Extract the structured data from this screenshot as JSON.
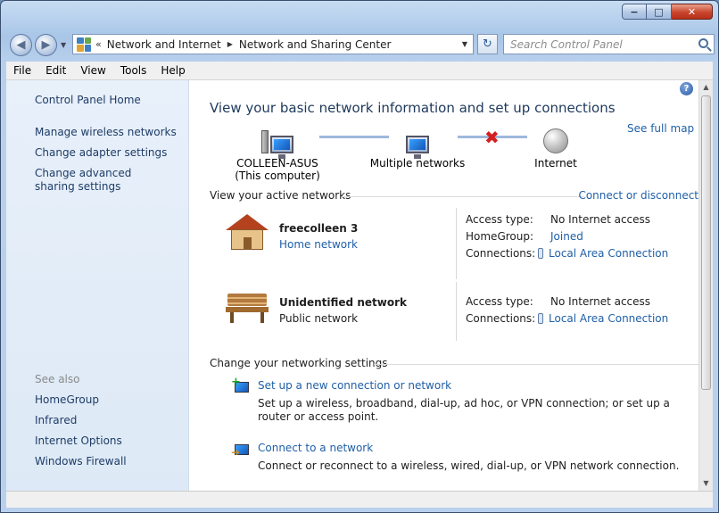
{
  "window": {
    "min_label": "−",
    "max_label": "□",
    "close_label": "✕"
  },
  "nav": {
    "back_glyph": "◀",
    "forward_glyph": "▶",
    "dropdown_glyph": "▼",
    "breadcrumb_overflow": "«",
    "breadcrumb": [
      "Network and Internet",
      "Network and Sharing Center"
    ],
    "refresh_glyph": "↻",
    "search_placeholder": "Search Control Panel"
  },
  "menu": [
    "File",
    "Edit",
    "View",
    "Tools",
    "Help"
  ],
  "sidebar": {
    "home": "Control Panel Home",
    "tasks": [
      "Manage wireless networks",
      "Change adapter settings",
      "Change advanced sharing settings"
    ],
    "see_also_label": "See also",
    "see_also": [
      "HomeGroup",
      "Infrared",
      "Internet Options",
      "Windows Firewall"
    ]
  },
  "main": {
    "help_glyph": "?",
    "title": "View your basic network information and set up connections",
    "see_full_map": "See full map",
    "map": {
      "computer_name": "COLLEEN-ASUS",
      "computer_sub": "(This computer)",
      "middle": "Multiple networks",
      "internet": "Internet",
      "broken_glyph": "✖"
    },
    "active_header": "View your active networks",
    "connect_link": "Connect or disconnect",
    "networks": [
      {
        "name": "freecolleen  3",
        "type": "Home network",
        "props": [
          {
            "label": "Access type:",
            "value": "No Internet access"
          },
          {
            "label": "HomeGroup:",
            "value": "Joined"
          },
          {
            "label": "Connections:",
            "value": "Local Area Connection"
          }
        ]
      },
      {
        "name": "Unidentified network",
        "type": "Public network",
        "props": [
          {
            "label": "Access type:",
            "value": "No Internet access"
          },
          {
            "label": "Connections:",
            "value": "Local Area Connection"
          }
        ]
      }
    ],
    "change_header": "Change your networking settings",
    "tasks": [
      {
        "link": "Set up a new connection or network",
        "desc": "Set up a wireless, broadband, dial-up, ad hoc, or VPN connection; or set up a router or access point."
      },
      {
        "link": "Connect to a network",
        "desc": "Connect or reconnect to a wireless, wired, dial-up, or VPN network connection."
      }
    ]
  },
  "colors": {
    "link": "#1f5fa7",
    "title": "#1e395b",
    "sidebar_bg": "#e8f0fa",
    "error": "#d21f1f"
  },
  "icons": [
    "network-center-icon",
    "refresh-icon",
    "search-icon",
    "help-icon",
    "computer-icon",
    "multiple-networks-icon",
    "globe-icon",
    "home-network-icon",
    "public-network-icon",
    "connection-plug-icon",
    "new-connection-icon",
    "connect-network-icon"
  ]
}
